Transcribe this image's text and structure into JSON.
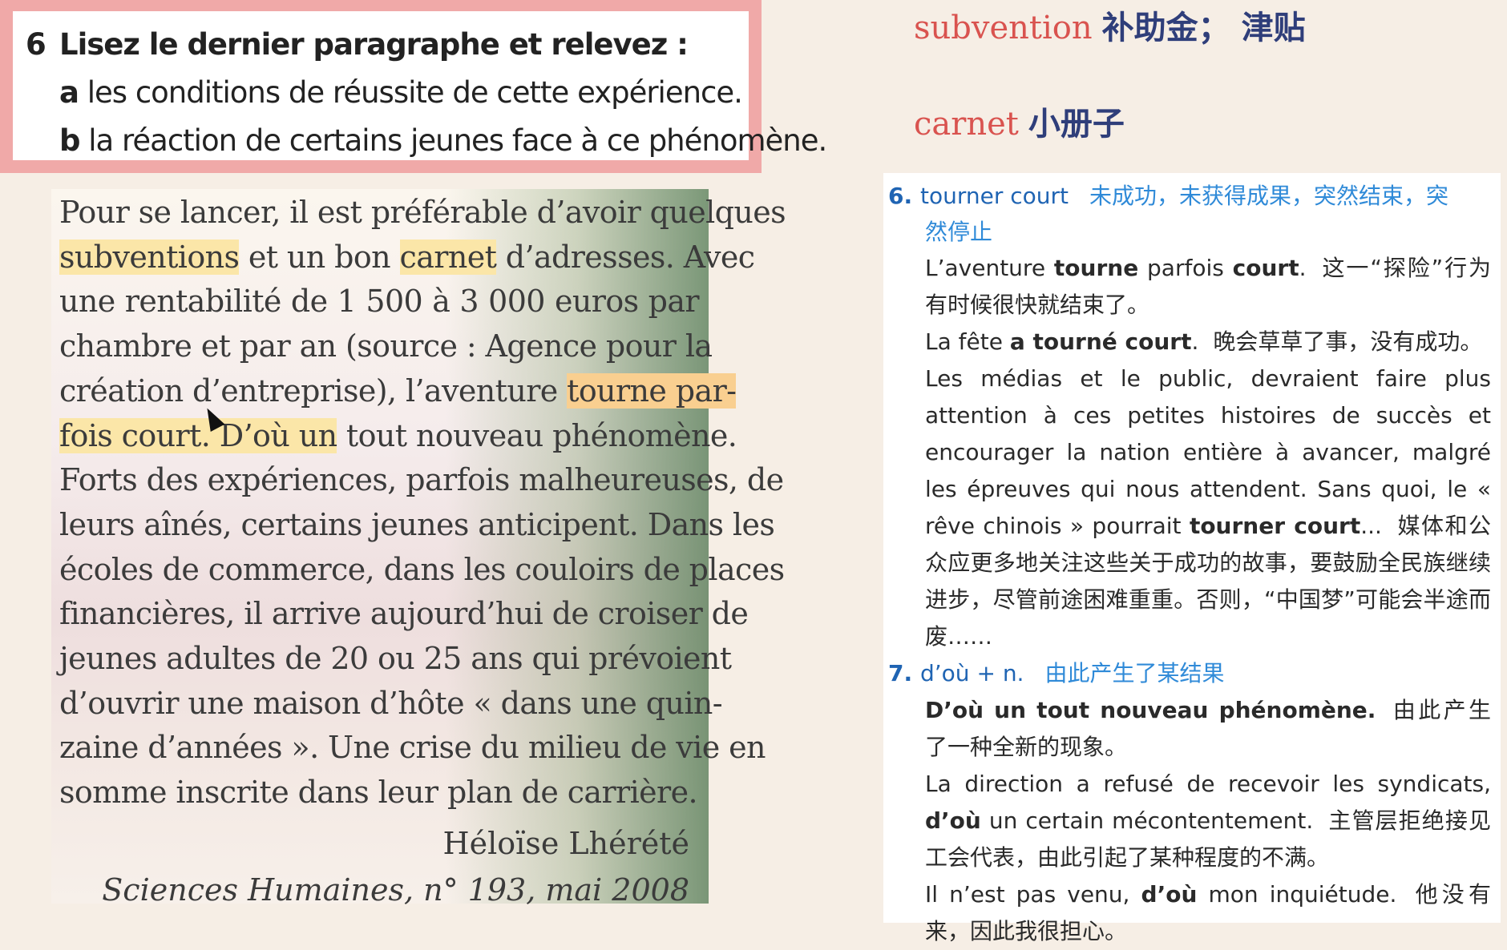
{
  "exercise": {
    "number": "6",
    "instruction": "Lisez le dernier paragraphe et relevez :",
    "items": [
      {
        "letter": "a",
        "text": "les conditions de réussite de cette expérience."
      },
      {
        "letter": "b",
        "text": "la réaction de certains jeunes face à ce phénomène."
      }
    ]
  },
  "passage": {
    "lines": [
      {
        "a": "Pour se lancer, il est préférable d’avoir quelques"
      },
      {
        "hl1": "subventions",
        "b": " et un bon ",
        "hl2": "carnet",
        "c": " d’adresses. Avec"
      },
      {
        "a": "une rentabilité de 1 500 à 3 000 euros par"
      },
      {
        "a": "chambre et par an (source : Agence pour la"
      },
      {
        "a": "création d’entreprise), l’aventure ",
        "hl_o": "tourne par-"
      },
      {
        "hl1": "fois court.",
        "hl2": " D’où un",
        "c": " tout nouveau phénomène."
      },
      {
        "a": "Forts des expériences, parfois malheureuses, de"
      },
      {
        "a": "leurs aînés, certains jeunes anticipent. Dans les"
      },
      {
        "a": "écoles de commerce, dans les couloirs de places"
      },
      {
        "a": "financières, il arrive aujourd’hui de croiser de"
      },
      {
        "a": "jeunes adultes de 20 ou 25 ans qui prévoient"
      },
      {
        "a": "d’ouvrir une maison d’hôte « dans une quin-"
      },
      {
        "a": "zaine d’années ». Une crise du milieu de vie en"
      },
      {
        "a": "somme inscrite dans leur plan de carrière."
      }
    ],
    "author": "Héloïse Lhérété",
    "source": "Sciences Humaines, n° 193, mai 2008"
  },
  "vocab": [
    {
      "fr": "subvention",
      "zh": "补助金； 津贴"
    },
    {
      "fr": "carnet",
      "zh": "小册子"
    }
  ],
  "dict": {
    "entries": [
      {
        "num": "6.",
        "term": "tourner court",
        "def": "未成功，未获得成果，突然结束，突",
        "def_cont": "然停止",
        "examples": [
          {
            "fr_pre": "L’aventure ",
            "fr_b1": "tourne",
            "fr_mid": " parfois ",
            "fr_b2": "court",
            "fr_post": ".",
            "zh": "这一“探险”行为有时候很快就结束了。"
          },
          {
            "fr_pre": "La fête ",
            "fr_b1": "a tourné court",
            "fr_mid": ".",
            "fr_b2": "",
            "fr_post": "",
            "zh": "晚会草草了事，没有成功。"
          },
          {
            "fr_pre": "Les médias et le public, devraient faire plus attention à ces petites histoires de succès et encourager la nation entière à avancer, malgré les épreuves qui nous attendent. Sans quoi, le « rêve chinois » pourrait ",
            "fr_b1": "tourner court",
            "fr_mid": "...",
            "fr_b2": "",
            "fr_post": "",
            "zh": "媒体和公众应更多地关注这些关于成功的故事，要鼓励全民族继续进步，尽管前途困难重重。否则，“中国梦”可能会半途而废……"
          }
        ]
      },
      {
        "num": "7.",
        "term": "d’où + n.",
        "def": "由此产生了某结果",
        "def_cont": "",
        "examples": [
          {
            "fr_pre": "",
            "fr_b1": "D’où un tout nouveau phénomène.",
            "fr_mid": "",
            "fr_b2": "",
            "fr_post": "",
            "zh": "由此产生了一种全新的现象。"
          },
          {
            "fr_pre": "La direction a refusé de recevoir les syndicats, ",
            "fr_b1": "d’où",
            "fr_mid": " un certain mécontentement.",
            "fr_b2": "",
            "fr_post": "",
            "zh": "主管层拒绝接见工会代表，由此引起了某种程度的不满。"
          },
          {
            "fr_pre": "Il n’est pas venu, ",
            "fr_b1": "d’où",
            "fr_mid": " mon inquiétude.",
            "fr_b2": "",
            "fr_post": "",
            "zh": "他没有来，因此我很担心。"
          }
        ]
      }
    ]
  }
}
